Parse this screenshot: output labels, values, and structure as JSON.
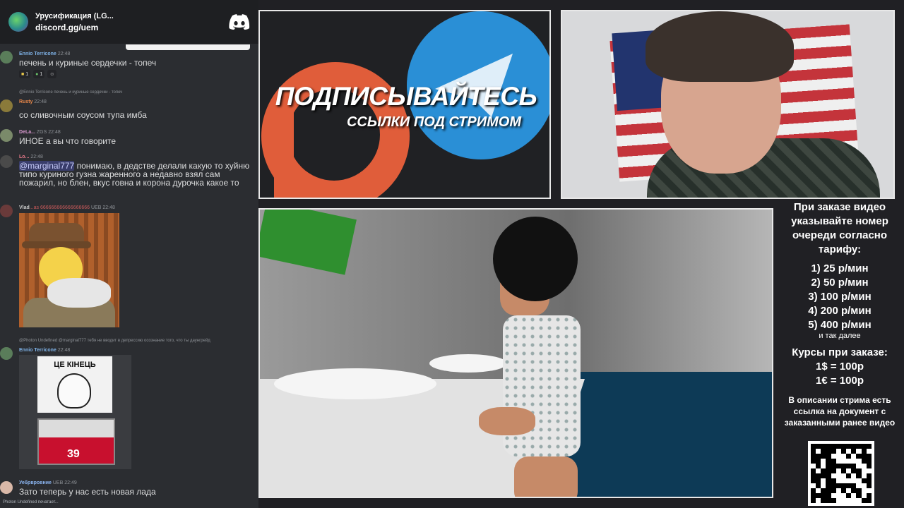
{
  "discord": {
    "server_name": "Урусификация (LG...",
    "invite": "discord.gg/uem"
  },
  "messages": [
    {
      "user": "Ennio Terricone",
      "time": "22:48",
      "text": "печень и куриные сердечки - топеч",
      "reactions": [
        "1",
        "1"
      ]
    },
    {
      "user": "Rusty",
      "reply": "@Ennio Terricone печень и куриные сердечки - топеч",
      "time": "22:48",
      "text": "со сливочным соусом тупа имба"
    },
    {
      "user": "DeLa...",
      "badge": "ZGS",
      "time": "22:48",
      "text": "ИНОЕ а  вы что говорите"
    },
    {
      "user": "Lo...",
      "time": "22:48",
      "mention": "@marginal777",
      "text": " понимаю, в дедстве делали какую то хуйню типо куриного гузна жаренного а недавно взял сам пожарил, но блен, вкус говна и корона дурочка какое то"
    },
    {
      "user": "Vlad",
      "name_suffix": "...as 666666666666666666",
      "badge": "UEB",
      "time": "22:48"
    },
    {
      "user": "Ennio Terricone",
      "reply": "@Photon Undefined @marginal777 тебя не вводит в депрессию осознание того, что ты даунгрейд",
      "time": "22:48",
      "meme_caption": "ЦЕ КІНЕЦЬ",
      "meme_number": "39"
    },
    {
      "user": "Уебрвровние",
      "badge": "UEB",
      "time": "22:49",
      "text": "Зато теперь у нас есть новая лада"
    }
  ],
  "typing": "Photon Undefined печатает...",
  "promo": {
    "title": "ПОДПИСЫВАЙТЕСЬ",
    "subtitle": "ССЫЛКИ ПОД СТРИМОМ"
  },
  "info": {
    "intro": "При заказе видео указывайте номер очереди согласно тарифу:",
    "tariffs": [
      "1) 25 р/мин",
      "2) 50 р/мин",
      "3) 100 р/мин",
      "4) 200 р/мин",
      "5) 400 р/мин"
    ],
    "etc": "и так далее",
    "rates_title": "Курсы при заказе:",
    "rates": [
      "1$ = 100р",
      "1€ = 100р"
    ],
    "desc": "В описании стрима есть ссылка на документ с заказанными ранее видео"
  },
  "colors": {
    "discord_bg": "#2b2d31",
    "patreon": "#e05d3a",
    "telegram": "#2a8fd6"
  }
}
